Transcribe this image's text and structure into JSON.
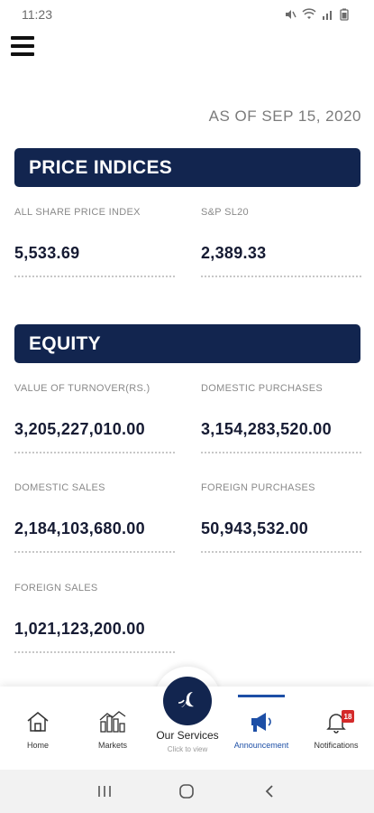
{
  "status_bar": {
    "time": "11:23"
  },
  "as_of": "AS OF SEP 15, 2020",
  "sections": {
    "price_indices": {
      "title": "PRICE INDICES",
      "items": [
        {
          "label": "ALL SHARE PRICE INDEX",
          "value": "5,533.69"
        },
        {
          "label": "S&P SL20",
          "value": "2,389.33"
        }
      ]
    },
    "equity": {
      "title": "EQUITY",
      "items": [
        {
          "label": "VALUE OF TURNOVER(RS.)",
          "value": "3,205,227,010.00"
        },
        {
          "label": "DOMESTIC PURCHASES",
          "value": "3,154,283,520.00"
        },
        {
          "label": "DOMESTIC SALES",
          "value": "2,184,103,680.00"
        },
        {
          "label": "FOREIGN PURCHASES",
          "value": "50,943,532.00"
        },
        {
          "label": "FOREIGN SALES",
          "value": "1,021,123,200.00"
        }
      ]
    }
  },
  "tabbar": {
    "home": "Home",
    "markets": "Markets",
    "our_services": "Our Services",
    "our_services_sub": "Click to view",
    "announcement": "Announcement",
    "notifications": "Notifications",
    "notification_count": "18",
    "active_tab": "Announcement"
  },
  "colors": {
    "header_bg": "#12254f",
    "accent": "#1d4fa6",
    "badge": "#d42a2a"
  }
}
